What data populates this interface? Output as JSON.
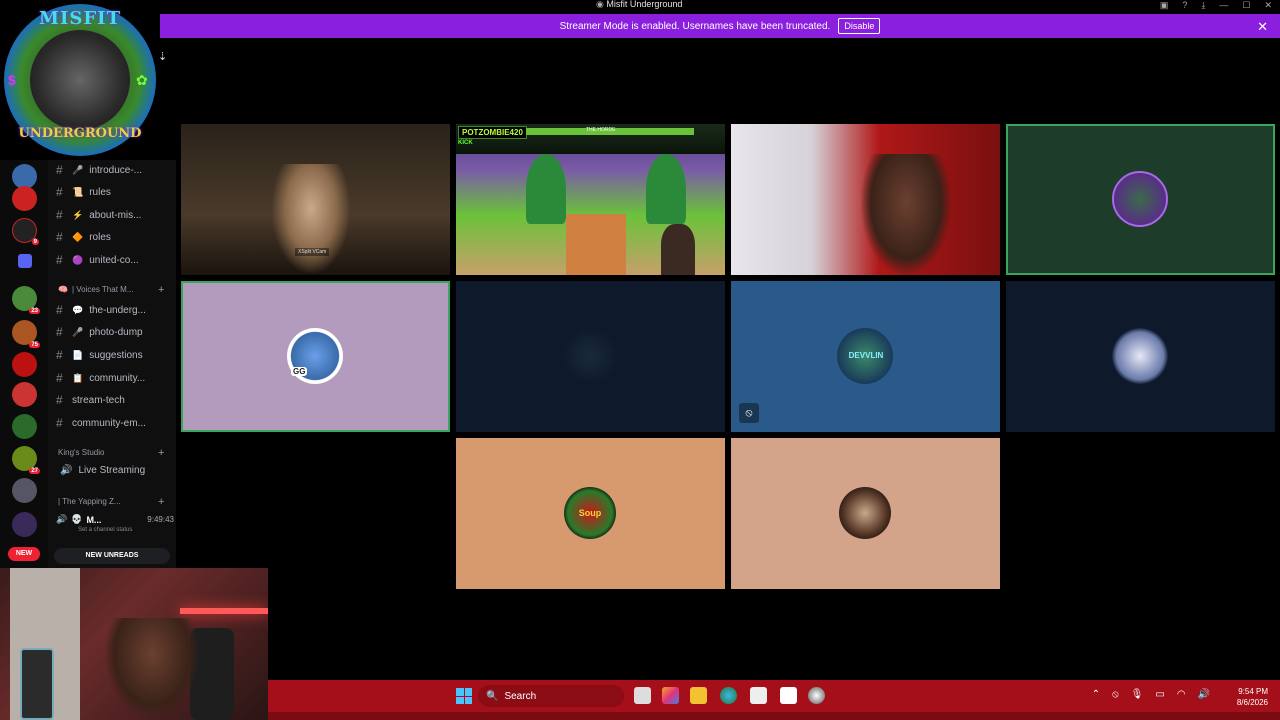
{
  "window": {
    "title": "Misfit Underground",
    "app_tag": "Ai"
  },
  "banner": {
    "message": "Streamer Mode is enabled. Usernames have been truncated.",
    "disable_label": "Disable"
  },
  "logo": {
    "line1": "MISFIT",
    "line2": "UNDERGROUND"
  },
  "channels": [
    {
      "name": "introduce-...",
      "emoji": "🎤"
    },
    {
      "name": "rules",
      "emoji": "📜"
    },
    {
      "name": "about-mis...",
      "emoji": "⚡"
    },
    {
      "name": "roles",
      "emoji": "🔶"
    },
    {
      "name": "united-co...",
      "emoji": "🟣"
    }
  ],
  "category_voices": "| Voices That M...",
  "channels2": [
    {
      "name": "the-underg...",
      "emoji": "💬"
    },
    {
      "name": "photo-dump",
      "emoji": "🎤"
    },
    {
      "name": "suggestions",
      "emoji": "📄"
    },
    {
      "name": "community...",
      "emoji": "📋"
    },
    {
      "name": "stream-tech",
      "emoji": ""
    },
    {
      "name": "community-em...",
      "emoji": ""
    }
  ],
  "category_kings": "King's Studio",
  "voice_channel": "Live Streaming",
  "category_yapping": "| The Yapping Z...",
  "voice_user": {
    "name": "M...",
    "timer": "9:49:43",
    "status": "Set a channel status"
  },
  "new_unreads": "NEW UNREADS",
  "new_pill": "NEW",
  "server_badges": [
    "9",
    "23",
    "75",
    "27"
  ],
  "tiles": {
    "cam1_label": "XSplit VCam",
    "game_name": "POTZOMBIE420",
    "game_kick": "KICK",
    "game_wave": "THE HORDE",
    "avatar_gg": "GG",
    "avatar_devvlin": "DEVVLIN",
    "avatar_soup": "Soup"
  },
  "taskbar": {
    "search_placeholder": "Search",
    "time": "9:54 PM",
    "date": "8/6/2026"
  },
  "colors": {
    "banner": "#8a1fdd",
    "speaking": "#3ba55d",
    "taskbar": "#a50f1a",
    "tile_navy": "#0e1a2b",
    "tile_blue": "#2a5a8a",
    "tile_lilac": "#b39bbd",
    "tile_peach": "#d69a6e",
    "tile_tan": "#d3a48a"
  },
  "icons": [
    "search-icon",
    "windows-icon",
    "close-icon",
    "streaming-icon",
    "mic-icon",
    "plus-icon",
    "hash-icon",
    "pin-icon"
  ]
}
